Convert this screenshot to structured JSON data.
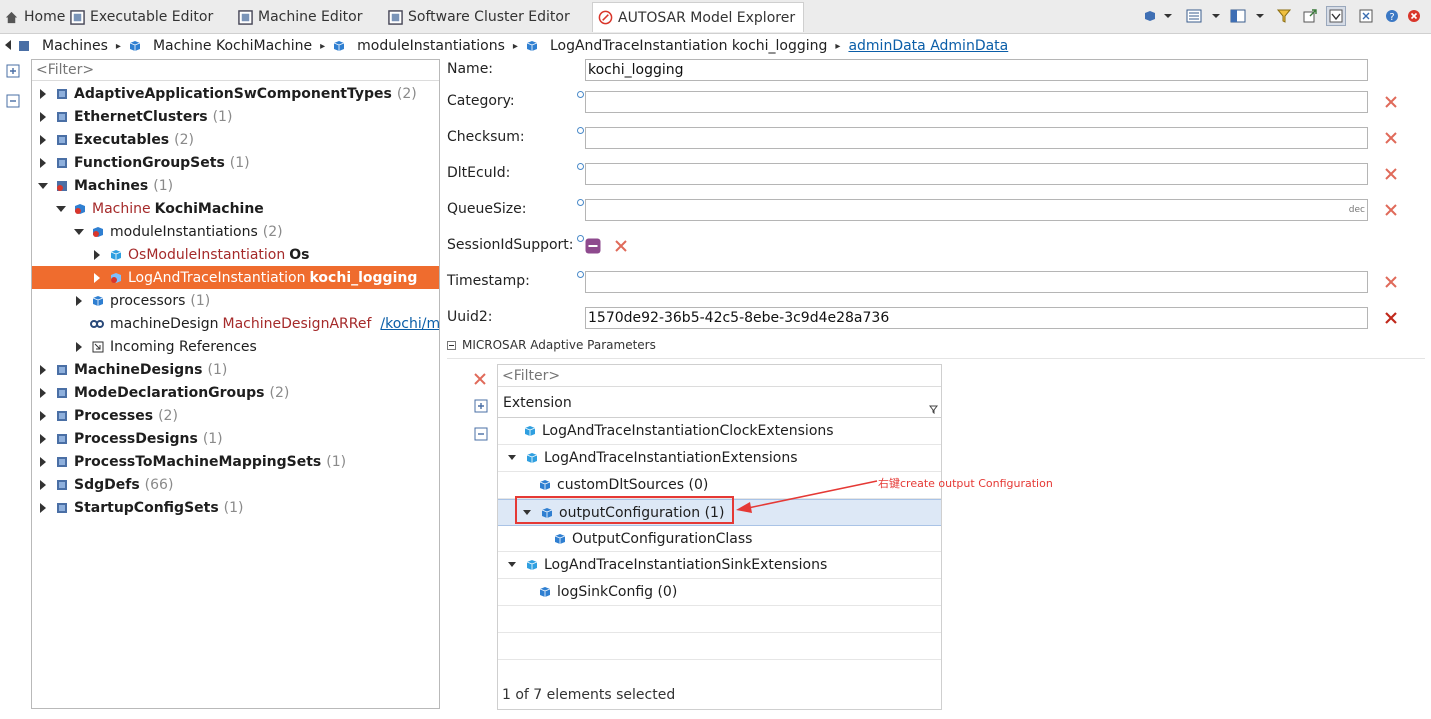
{
  "tabs": [
    {
      "label": "Home",
      "icon": "home-icon"
    },
    {
      "label": "Executable Editor",
      "icon": "editor-icon"
    },
    {
      "label": "Machine Editor",
      "icon": "editor-icon"
    },
    {
      "label": "Software Cluster Editor",
      "icon": "editor-icon"
    },
    {
      "label": "AUTOSAR Model Explorer",
      "icon": "autosar-icon",
      "active": true
    }
  ],
  "breadcrumb": {
    "items": [
      "Machines",
      "Machine KochiMachine",
      "moduleInstantiations",
      "LogAndTraceInstantiation kochi_logging"
    ],
    "link": "adminData AdminData"
  },
  "tree": {
    "filter_placeholder": "<Filter>",
    "nodes": [
      {
        "name": "AdaptiveApplicationSwComponentTypes",
        "count": "(2)"
      },
      {
        "name": "EthernetClusters",
        "count": "(1)"
      },
      {
        "name": "Executables",
        "count": "(2)"
      },
      {
        "name": "FunctionGroupSets",
        "count": "(1)"
      },
      {
        "name": "Machines",
        "count": "(1)"
      },
      {
        "kind": "Machine",
        "name": "KochiMachine"
      },
      {
        "name": "moduleInstantiations",
        "count": "(2)"
      },
      {
        "kind": "OsModuleInstantiation",
        "name": "Os"
      },
      {
        "kind": "LogAndTraceInstantiation",
        "name": "kochi_logging"
      },
      {
        "name": "processors",
        "count": "(1)"
      },
      {
        "name": "machineDesign",
        "kind": "MachineDesignARRef",
        "link": "/kochi/machineDesign"
      },
      {
        "name": "Incoming References"
      },
      {
        "name": "MachineDesigns",
        "count": "(1)"
      },
      {
        "name": "ModeDeclarationGroups",
        "count": "(2)"
      },
      {
        "name": "Processes",
        "count": "(2)"
      },
      {
        "name": "ProcessDesigns",
        "count": "(1)"
      },
      {
        "name": "ProcessToMachineMappingSets",
        "count": "(1)"
      },
      {
        "name": "SdgDefs",
        "count": "(66)"
      },
      {
        "name": "StartupConfigSets",
        "count": "(1)"
      }
    ]
  },
  "form": {
    "name_label": "Name:",
    "name_value": "kochi_logging",
    "category_label": "Category:",
    "checksum_label": "Checksum:",
    "dltecuid_label": "DltEcuId:",
    "queuesize_label": "QueueSize:",
    "queuesize_hint": "dec",
    "sessionid_label": "SessionIdSupport:",
    "timestamp_label": "Timestamp:",
    "uuid_label": "Uuid2:",
    "uuid_value": "1570de92-36b5-42c5-8ebe-3c9d4e28a736"
  },
  "section": {
    "title": "MICROSAR Adaptive Parameters"
  },
  "extensions": {
    "filter_placeholder": "<Filter>",
    "header": "Extension",
    "rows": [
      {
        "label": "LogAndTraceInstantiationClockExtensions"
      },
      {
        "label": "LogAndTraceInstantiationExtensions"
      },
      {
        "label": "customDltSources (0)"
      },
      {
        "label": "outputConfiguration (1)"
      },
      {
        "label": "OutputConfigurationClass"
      },
      {
        "label": "LogAndTraceInstantiationSinkExtensions"
      },
      {
        "label": "logSinkConfig (0)"
      }
    ],
    "status": "1 of 7 elements selected"
  },
  "annotation": {
    "text": "右键create output Configuration",
    "color": "#e53935"
  },
  "colors": {
    "selection": "#ef6c2e",
    "kind_text": "#a52a2a",
    "link": "#0b5ea8",
    "cube": "#2f7fd1"
  }
}
